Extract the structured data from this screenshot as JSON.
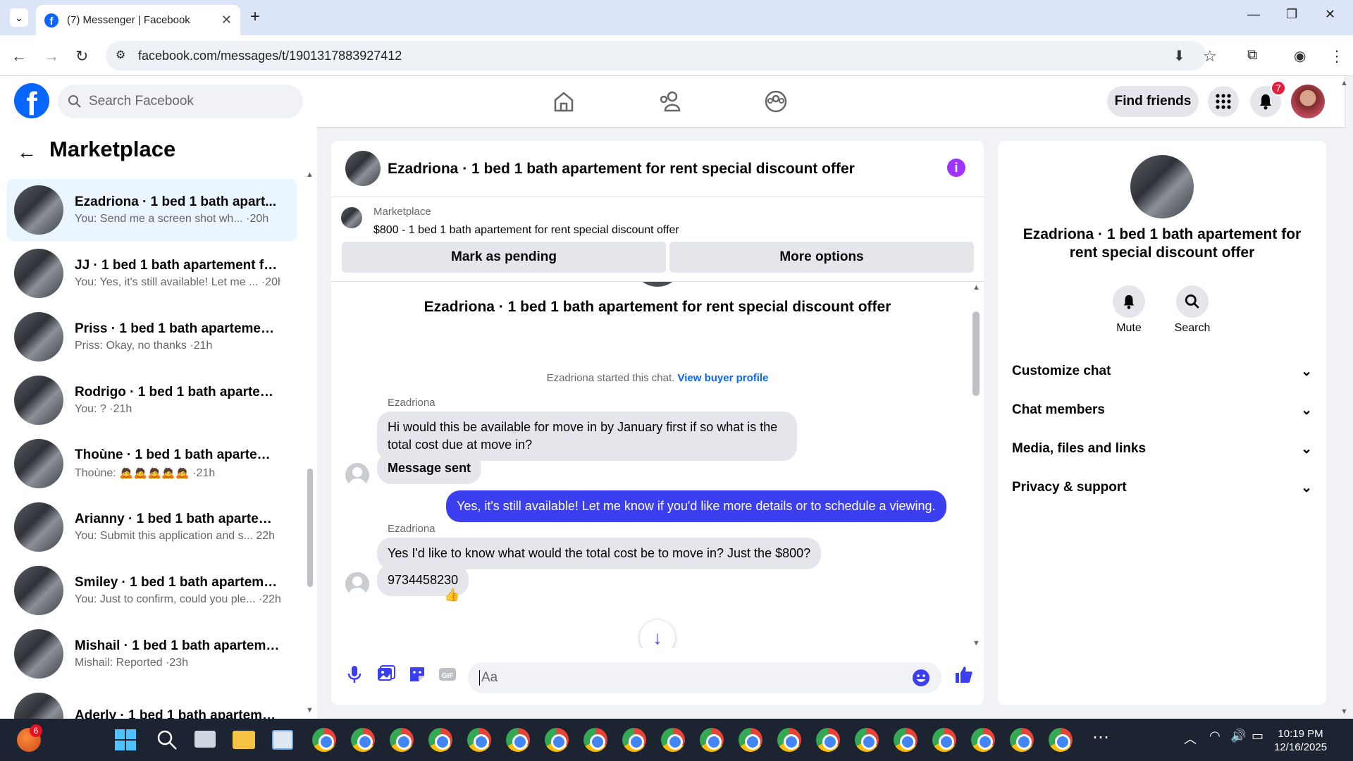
{
  "browser": {
    "tab_title": "(7) Messenger | Facebook",
    "url": "facebook.com/messages/t/1901317883927412"
  },
  "fb": {
    "search_placeholder": "Search Facebook",
    "find_friends": "Find friends",
    "notification_count": "7"
  },
  "sidebar": {
    "title": "Marketplace",
    "conversations": [
      {
        "name": "Ezadriona · 1 bed 1 bath apart...",
        "preview": "You: Send me a screen shot wh... ·20h",
        "selected": true
      },
      {
        "name": "JJ · 1 bed 1 bath apartement for ...",
        "preview": "You: Yes, it's still available! Let me ... ·20h"
      },
      {
        "name": "Priss · 1 bed 1 bath apartement f...",
        "preview": "Priss: Okay, no thanks ·21h"
      },
      {
        "name": "Rodrigo · 1 bed 1 bath aparteme...",
        "preview": "You: ? ·21h"
      },
      {
        "name": "Thoùne · 1 bed 1 bath aparteme...",
        "preview": "Thoùne: 🙇🙇🙇🙇🙇 ·21h"
      },
      {
        "name": "Arianny · 1 bed 1 bath aparteme...",
        "preview": "You: Submit this application and s... 22h"
      },
      {
        "name": "Smiley · 1 bed 1 bath apartemen...",
        "preview": "You: Just to confirm, could you ple... ·22h"
      },
      {
        "name": "Mishail · 1 bed 1 bath apartemen...",
        "preview": "Mishail: Reported ·23h"
      },
      {
        "name": "Aderly · 1 bed 1 bath apartemen...",
        "preview": ""
      }
    ]
  },
  "chat": {
    "title": "Ezadriona · 1 bed 1 bath apartement for rent special discount offer",
    "marketplace_label": "Marketplace",
    "listing": "$800 - 1 bed 1 bath apartement for rent special discount offer",
    "mark_pending": "Mark as pending",
    "more_options": "More options",
    "started_text": "Ezadriona started this chat.",
    "view_buyer": "View buyer profile",
    "sender_name": "Ezadriona",
    "messages": [
      {
        "text": "Hi would this be available for move in by January first if so what is the total cost due at move in?"
      },
      {
        "text": "Message sent"
      },
      {
        "text": "Yes, it's still available! Let me know if you'd like more details or to schedule a viewing."
      },
      {
        "text": "Yes I'd like to know what would the total cost be to move in? Just the $800?"
      },
      {
        "text": "9734458230"
      }
    ],
    "input_placeholder": "Aa"
  },
  "details": {
    "title": "Ezadriona · 1 bed 1 bath apartement for rent special discount offer",
    "mute": "Mute",
    "search": "Search",
    "sections": [
      "Customize chat",
      "Chat members",
      "Media, files and links",
      "Privacy & support"
    ]
  },
  "taskbar": {
    "time": "10:19 PM",
    "date": "12/16/2025",
    "badge": "6"
  }
}
